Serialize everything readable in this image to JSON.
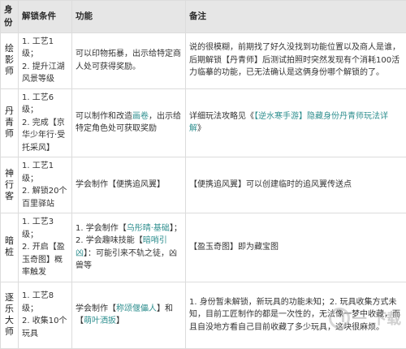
{
  "headers": [
    "身份",
    "解锁条件",
    "功能",
    "备注"
  ],
  "rows": [
    {
      "role": "绘影师",
      "cond": [
        "1. 工艺1级；",
        "2. 提升江湖风景等级"
      ],
      "func": [
        [
          {
            "t": "可以印物拓暴，出示给特定商人处可获得奖励。"
          }
        ]
      ],
      "note": [
        [
          {
            "t": "说的很模糊，前期找了好久没找到功能位置以及商人是谁，后期解锁【丹青师】后测试拍照时突然发现有个消耗100活力临摹的功能，已无法确认是这俩身份哪个解锁的了。"
          }
        ]
      ]
    },
    {
      "role": "丹青师",
      "cond": [
        "1. 工艺6级；",
        "2. 完成【京华少年行·受托采风】"
      ],
      "func": [
        [
          {
            "t": "可以制作和改造"
          },
          {
            "t": "画卷",
            "hl": true
          },
          {
            "t": "，出示给特定角色处可获取奖励"
          }
        ]
      ],
      "note": [
        [
          {
            "t": "详细玩法攻略见《"
          },
          {
            "t": "【逆水寒手游】隐藏身份丹青师玩法详解",
            "hl": true
          },
          {
            "t": "》"
          }
        ]
      ]
    },
    {
      "role": "神行客",
      "cond": [
        "1. 工艺1级；",
        "2. 解锁20个百里驿站"
      ],
      "func": [
        [
          {
            "t": "学会制作【便携追风翼】"
          }
        ]
      ],
      "note": [
        [
          {
            "t": "【便携追风翼】可以创建临时的追风翼传送点"
          }
        ]
      ]
    },
    {
      "role": "暗桩",
      "cond": [
        "1. 工艺3级；",
        "2. 开启【盈玉奇图】概率触发"
      ],
      "func": [
        [
          {
            "t": "1. 学会制作【"
          },
          {
            "t": "乌彤晴·基础",
            "hl": true
          },
          {
            "t": "】；"
          }
        ],
        [
          {
            "t": "2. 学会趣味技能【"
          },
          {
            "t": "暗哨引凶",
            "hl": true
          },
          {
            "t": "】：可能引来不轨之徒，凶兽等"
          }
        ]
      ],
      "note": [
        [
          {
            "t": "【盈玉奇图】即为藏宝图"
          }
        ]
      ]
    },
    {
      "role": "逐乐大师",
      "cond": [
        "1. 工艺8级；",
        "2. 收集10个玩具"
      ],
      "func": [
        [
          {
            "t": "学会制作【"
          },
          {
            "t": "称颂偃儡人",
            "hl": true
          },
          {
            "t": "】和【"
          },
          {
            "t": "萌叶洒扳",
            "hl": true
          },
          {
            "t": "】"
          }
        ]
      ],
      "note": [
        [
          {
            "t": "1. 身份暂未解锁，新玩具的功能未知；2. 玩具收集方式未知，目前工匠制作的都是一次性的，无法像一梦中收藏，而且自没地方看自己目前收藏了多少玩具，这块很麻烦。"
          }
        ]
      ]
    }
  ],
  "watermark": "一 下载"
}
